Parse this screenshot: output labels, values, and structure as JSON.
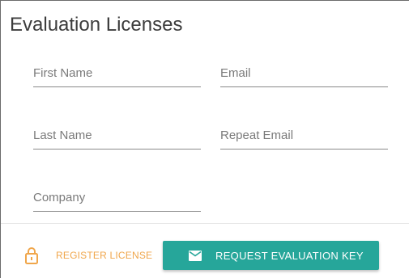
{
  "dialog": {
    "title": "Evaluation Licenses"
  },
  "form": {
    "first_name": {
      "placeholder": "First Name",
      "value": ""
    },
    "email": {
      "placeholder": "Email",
      "value": ""
    },
    "last_name": {
      "placeholder": "Last Name",
      "value": ""
    },
    "repeat_email": {
      "placeholder": "Repeat Email",
      "value": ""
    },
    "company": {
      "placeholder": "Company",
      "value": ""
    }
  },
  "actions": {
    "register_label": "REGISTER LICENSE",
    "register_icon": "lock-icon",
    "request_label": "REQUEST EVALUATION KEY",
    "request_icon": "mail-icon"
  },
  "colors": {
    "accent_teal": "#26a69a",
    "register_orange": "#f0a64b"
  }
}
